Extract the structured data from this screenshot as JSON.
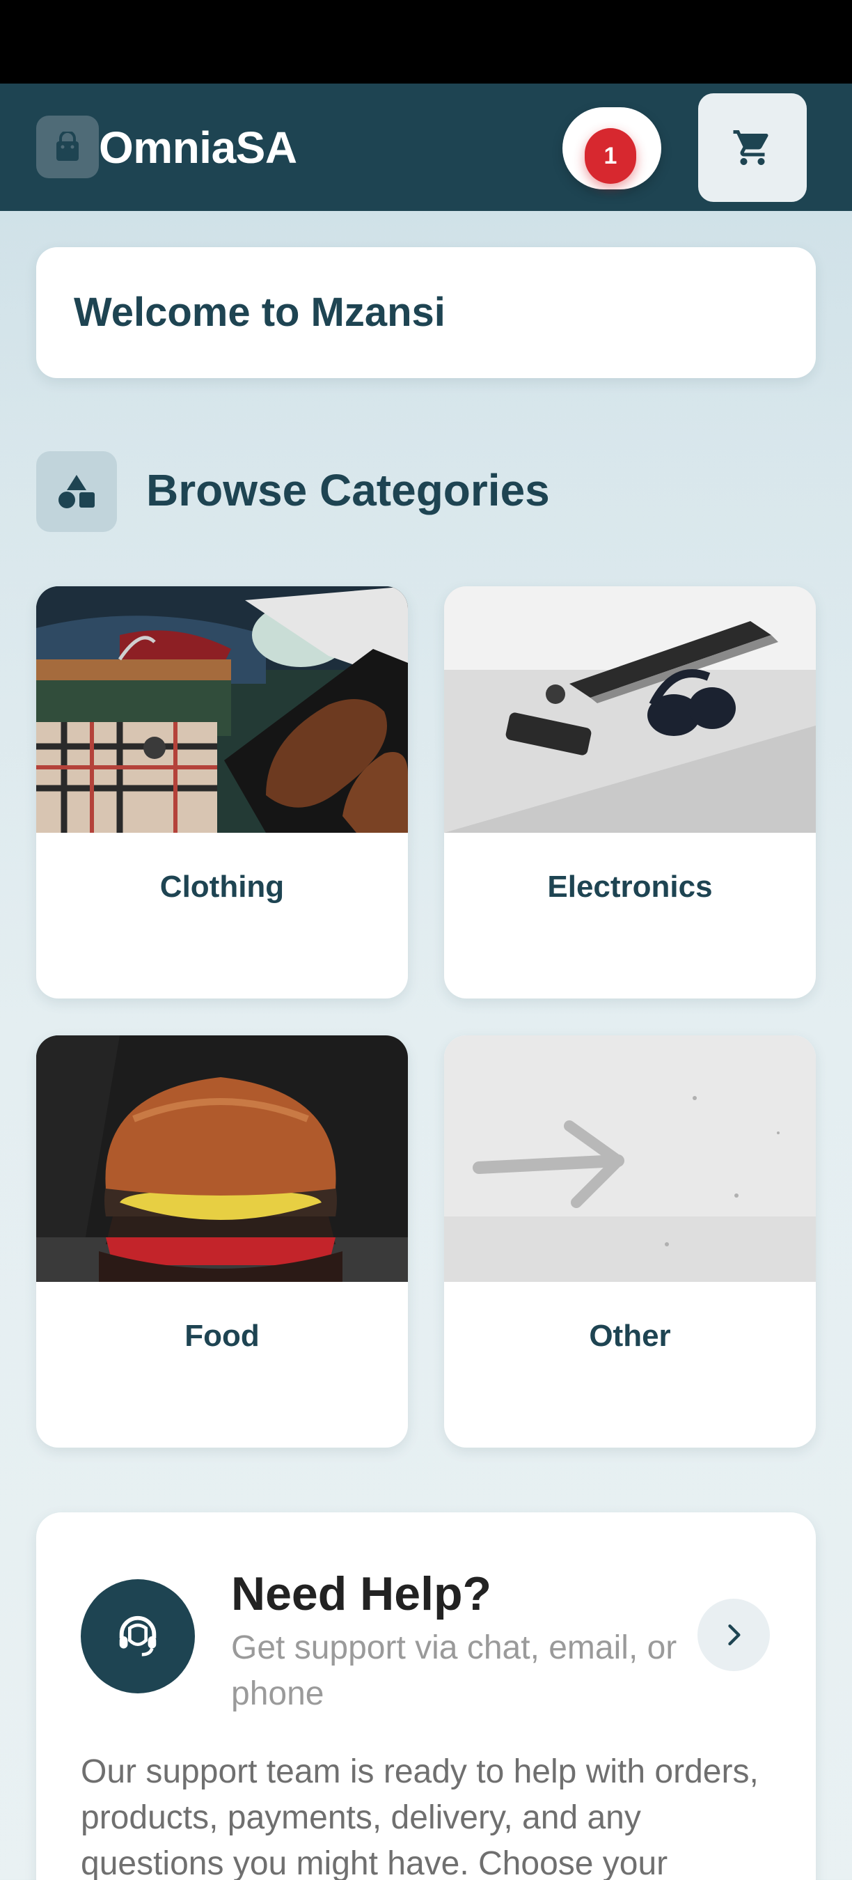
{
  "header": {
    "brand": "OmniaSA",
    "notification_count": "1",
    "logo_icon": "shopping-bag-icon",
    "cart_icon": "cart-icon"
  },
  "welcome": {
    "text": "Welcome to Mzansi"
  },
  "categories_section": {
    "title": "Browse Categories",
    "icon": "shapes-icon",
    "items": [
      {
        "label": "Clothing",
        "image": "clothing-photo"
      },
      {
        "label": "Electronics",
        "image": "electronics-photo"
      },
      {
        "label": "Food",
        "image": "burger-photo"
      },
      {
        "label": "Other",
        "image": "arrow-photo"
      }
    ]
  },
  "help": {
    "title": "Need Help?",
    "subtitle": "Get support via chat, email, or phone",
    "body": "Our support team is ready to help with orders, products, payments, delivery, and any questions you might have. Choose your",
    "icon": "headset-icon",
    "arrow_icon": "chevron-right-icon"
  },
  "colors": {
    "primary": "#1e4452",
    "badge": "#d7282f",
    "card": "#ffffff"
  }
}
